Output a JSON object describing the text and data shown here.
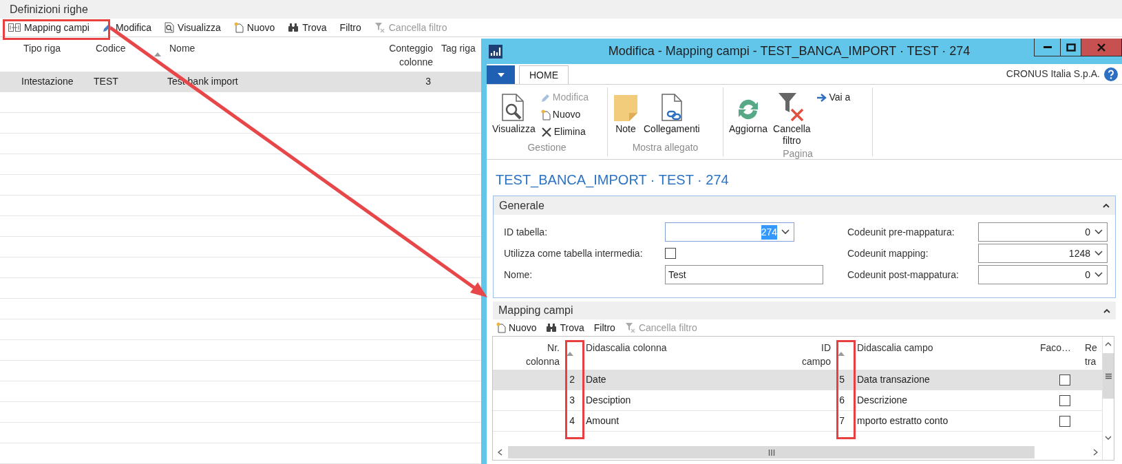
{
  "list_page": {
    "title": "Definizioni righe",
    "toolbar": [
      {
        "label": "Mapping campi",
        "disabled": false
      },
      {
        "label": "Modifica",
        "disabled": false
      },
      {
        "label": "Visualizza",
        "disabled": false
      },
      {
        "label": "Nuovo",
        "disabled": false
      },
      {
        "label": "Trova",
        "disabled": false
      },
      {
        "label": "Filtro",
        "disabled": false
      },
      {
        "label": "Cancella filtro",
        "disabled": true
      }
    ],
    "columns": [
      {
        "label": "Tipo riga"
      },
      {
        "label": "Codice",
        "sorted": true
      },
      {
        "label": "Nome"
      },
      {
        "label": "Conteggio colonne"
      },
      {
        "label": "Tag riga"
      }
    ],
    "rows": [
      {
        "selected": true,
        "cells": [
          "Intestazione",
          "TEST",
          "Test bank import",
          "3"
        ]
      }
    ]
  },
  "window": {
    "title": "Modifica - Mapping campi - TEST_BANCA_IMPORT · TEST · 274",
    "tabs": [
      {
        "label": "HOME",
        "selected": true
      }
    ],
    "company": "CRONUS Italia S.p.A.",
    "ribbon_groups": [
      {
        "label": "Gestione",
        "actions": [
          {
            "label": "Visualizza",
            "kind": "large",
            "disabled": false
          },
          {
            "label": "Modifica",
            "kind": "small",
            "disabled": true
          },
          {
            "label": "Nuovo",
            "kind": "small",
            "disabled": false
          },
          {
            "label": "Elimina",
            "kind": "small",
            "disabled": false
          }
        ]
      },
      {
        "label": "Mostra allegato",
        "actions": [
          {
            "label": "Note",
            "kind": "large",
            "disabled": false
          },
          {
            "label": "Collegamenti",
            "kind": "large",
            "disabled": false
          }
        ]
      },
      {
        "label": "Pagina",
        "actions": [
          {
            "label": "Aggiorna",
            "kind": "large",
            "disabled": false
          },
          {
            "label": "Cancella filtro",
            "kind": "large",
            "disabled": false
          },
          {
            "label": "Vai a",
            "kind": "small",
            "disabled": false
          }
        ]
      }
    ],
    "page_title": "TEST_BANCA_IMPORT · TEST · 274",
    "general": {
      "title": "Generale",
      "expanded": true,
      "left_fields": [
        {
          "label": "ID tabella:",
          "kind": "lookup",
          "value": "274",
          "text_selected": true
        },
        {
          "label": "Utilizza come tabella intermedia:",
          "kind": "checkbox",
          "checked": false
        },
        {
          "label": "Nome:",
          "kind": "text",
          "value": "Test"
        }
      ],
      "right_fields": [
        {
          "label": "Codeunit pre-mappatura:",
          "kind": "lookup",
          "value": "0",
          "text_selected": false
        },
        {
          "label": "Codeunit mapping:",
          "kind": "lookup",
          "value": "1248",
          "text_selected": false
        },
        {
          "label": "Codeunit post-mappatura:",
          "kind": "lookup",
          "value": "0",
          "text_selected": false
        }
      ]
    },
    "mapping": {
      "title": "Mapping campi",
      "expanded": true,
      "toolbar": [
        {
          "label": "Nuovo",
          "disabled": false
        },
        {
          "label": "Trova",
          "disabled": false
        },
        {
          "label": "Filtro",
          "disabled": false
        },
        {
          "label": "Cancella filtro",
          "disabled": true
        }
      ],
      "columns": [
        {
          "label": "Nr. colonna",
          "sorted": true
        },
        {
          "label": "Didascalia colonna"
        },
        {
          "label": "ID campo",
          "sorted": true
        },
        {
          "label": "Didascalia campo"
        },
        {
          "label": "Faco…"
        },
        {
          "label": "Re tra"
        }
      ],
      "rows": [
        {
          "selected": true,
          "column_no": "2",
          "column_caption": "Date",
          "field_id": "5",
          "field_caption": "Data transazione",
          "optional": false
        },
        {
          "selected": false,
          "column_no": "3",
          "column_caption": "Desciption",
          "field_id": "6",
          "field_caption": "Descrizione",
          "optional": false
        },
        {
          "selected": false,
          "column_no": "4",
          "column_caption": "Amount",
          "field_id": "7",
          "field_caption": "mporto estratto conto",
          "optional": false
        }
      ]
    }
  }
}
